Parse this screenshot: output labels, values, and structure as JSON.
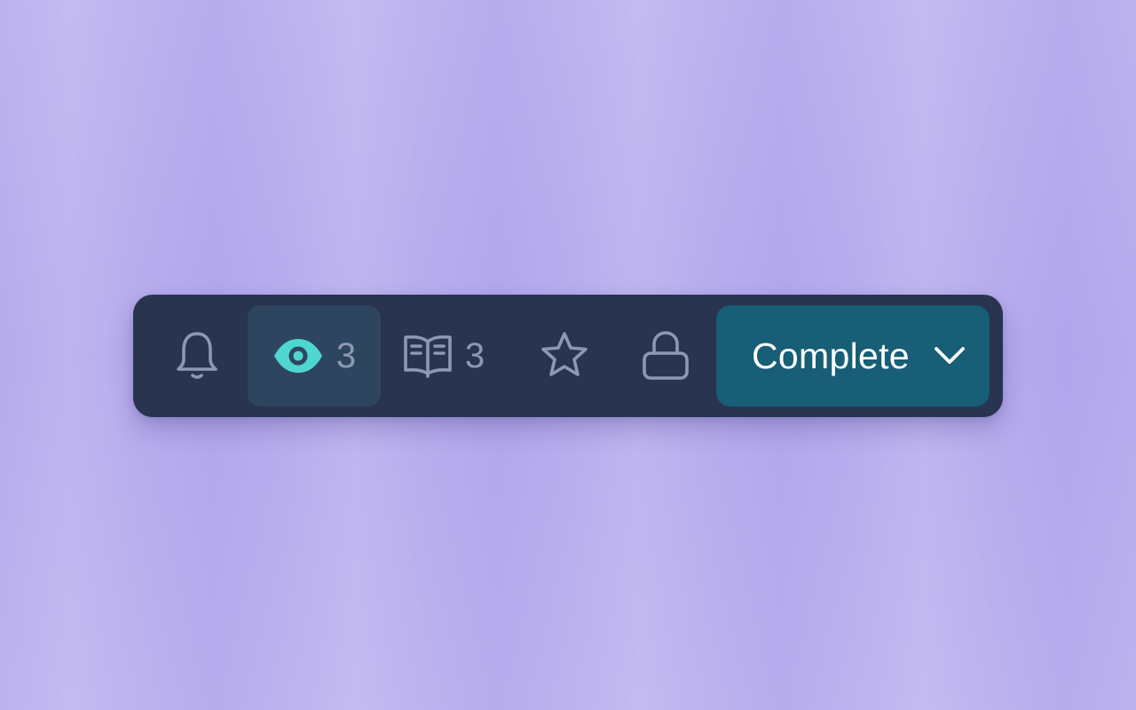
{
  "toolbar": {
    "items": [
      {
        "id": "notifications",
        "icon": "bell-icon",
        "active": false,
        "count": ""
      },
      {
        "id": "watchers",
        "icon": "eye-icon",
        "active": true,
        "count": "3"
      },
      {
        "id": "reading",
        "icon": "open-book-icon",
        "active": false,
        "count": "3"
      },
      {
        "id": "favorite",
        "icon": "star-icon",
        "active": false,
        "count": ""
      },
      {
        "id": "lock",
        "icon": "lock-icon",
        "active": false,
        "count": ""
      }
    ],
    "status_button": {
      "label": "Complete",
      "icon": "chevron-down-icon"
    }
  },
  "colors": {
    "background": "#b8aeee",
    "toolbar_bg": "#283450",
    "active_item_bg": "#2e4560",
    "icon_muted": "#8d98b4",
    "icon_active": "#4fd6d0",
    "status_button_bg": "#175e76",
    "status_button_text": "#ffffff"
  }
}
